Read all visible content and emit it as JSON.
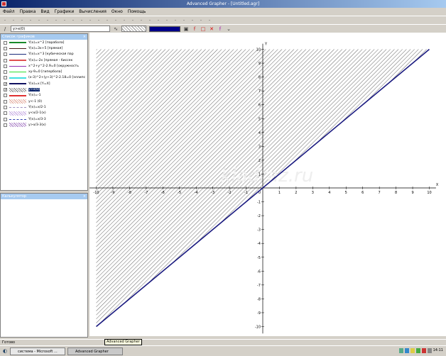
{
  "window": {
    "title": "Advanced Grapher - [Untitled.agr]"
  },
  "menu": [
    "Файл",
    "Правка",
    "Вид",
    "Графики",
    "Вычисления",
    "Окно",
    "Помощь"
  ],
  "toolbar2": {
    "graph_combo": "y>x(0)"
  },
  "graph_list": {
    "title": "Список графиков",
    "items": [
      {
        "label": "Y(x)=x^2 [парабола]",
        "checked": false,
        "style": "line",
        "color": "#1a8a2a"
      },
      {
        "label": "Y(x)=3x+5 [прямая]",
        "checked": false,
        "style": "line",
        "color": "#4a1a1a"
      },
      {
        "label": "Y(x)=x^3 [кубическая пар",
        "checked": false,
        "style": "line",
        "color": "#1a2a7a"
      },
      {
        "label": "Y(x)=-2x [прямая - биссек",
        "checked": false,
        "style": "line",
        "color": "#e05050"
      },
      {
        "label": "x^2+y^2-2.9=0 [окружность",
        "checked": false,
        "style": "line",
        "color": "#9030b0"
      },
      {
        "label": "xy-9=0 [гипербола]",
        "checked": false,
        "style": "line",
        "color": "#30e030"
      },
      {
        "label": "(x-3)^2+(y+3)^2-2.18=0 [эллипс",
        "checked": false,
        "style": "line",
        "color": "#40e0e0"
      },
      {
        "label": "Y(x)=x [Y=X]",
        "checked": true,
        "style": "line",
        "color": "#101060"
      },
      {
        "label": "y>x(0)",
        "checked": true,
        "style": "hatch",
        "color": "#777777",
        "selected": true
      },
      {
        "label": "Y(x)=-1",
        "checked": false,
        "style": "line",
        "color": "#e03030"
      },
      {
        "label": "y<-1 (0)",
        "checked": false,
        "style": "hatch",
        "color": "#e0a090"
      },
      {
        "label": "Y(x)=x/2-1",
        "checked": false,
        "style": "dash",
        "color": "#a090c0"
      },
      {
        "label": "y<x/2-1(x)",
        "checked": false,
        "style": "hatch",
        "color": "#c0a0e0"
      },
      {
        "label": "Y(x)=x/3-3",
        "checked": false,
        "style": "dash",
        "color": "#3040b0"
      },
      {
        "label": "y>x/3-3(x)",
        "checked": false,
        "style": "hatch",
        "color": "#a070c0"
      }
    ]
  },
  "calculator": {
    "title": "Калькулятор"
  },
  "chart_data": {
    "type": "line",
    "xlim": [
      -10,
      10
    ],
    "ylim": [
      -10,
      10
    ],
    "grid": false,
    "xticks": [
      -10,
      -9,
      -8,
      -7,
      -6,
      -5,
      -4,
      -3,
      -2,
      -1,
      1,
      2,
      3,
      4,
      5,
      6,
      7,
      8,
      9,
      10
    ],
    "yticks": [
      -10,
      -9,
      -8,
      -7,
      -6,
      -5,
      -4,
      -3,
      -2,
      -1,
      1,
      2,
      3,
      4,
      5,
      6,
      7,
      8,
      9,
      10
    ],
    "origin_label": "0",
    "x_axis_label": "X",
    "y_axis_label": "Y",
    "series": [
      {
        "expr": "Y(x)=x",
        "x": [
          -10,
          10
        ],
        "y": [
          -10,
          10
        ],
        "color": "#1a1a80"
      }
    ],
    "region": {
      "inequality": "y>x",
      "fill": "hatch",
      "color": "#555555"
    },
    "watermark": "kladraz.ru"
  },
  "status": {
    "text": "Готово",
    "tooltip": "Advanced Grapher"
  },
  "taskbar": {
    "tasks": [
      "система - Microsoft ...",
      "Advanced Grapher"
    ],
    "clock": "14:11"
  }
}
